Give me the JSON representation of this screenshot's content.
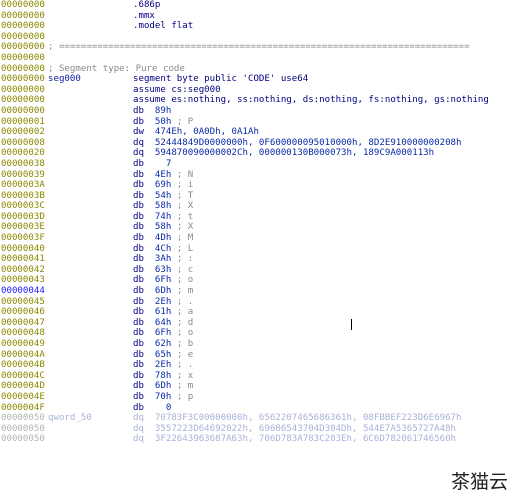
{
  "lines": [
    {
      "addr": "00000000",
      "kind": "instr",
      "mn": ".686p",
      "ops": "",
      "cmt": ""
    },
    {
      "addr": "00000000",
      "kind": "instr",
      "mn": ".mmx",
      "ops": "",
      "cmt": ""
    },
    {
      "addr": "00000000",
      "kind": "instr",
      "mn": ".model flat",
      "ops": "",
      "cmt": ""
    },
    {
      "addr": "00000000",
      "kind": "blank"
    },
    {
      "addr": "00000000",
      "kind": "comment",
      "text": "; ==========================================================================="
    },
    {
      "addr": "00000000",
      "kind": "blank"
    },
    {
      "addr": "00000000",
      "kind": "comment",
      "text": "; Segment type: Pure code"
    },
    {
      "addr": "00000000",
      "kind": "instr",
      "label": "seg000",
      "mn": "segment byte public 'CODE' use64",
      "ops": "",
      "cmt": ""
    },
    {
      "addr": "00000000",
      "kind": "instr",
      "mn": "assume cs:seg000",
      "ops": "",
      "cmt": ""
    },
    {
      "addr": "00000000",
      "kind": "instr",
      "mn": "assume es:nothing, ss:nothing, ds:nothing, fs:nothing, gs:nothing",
      "ops": "",
      "cmt": ""
    },
    {
      "addr": "00000000",
      "kind": "instr",
      "mn": "db",
      "ops": "89h",
      "cmt": ""
    },
    {
      "addr": "00000001",
      "kind": "instr",
      "mn": "db",
      "ops": "50h",
      "cmt": "; P"
    },
    {
      "addr": "00000002",
      "kind": "instr",
      "mn": "dw",
      "ops": "474Eh, 0A0Dh, 0A1Ah",
      "cmt": ""
    },
    {
      "addr": "00000008",
      "kind": "instr",
      "mn": "dq",
      "ops": "52444849D0000000h, 0F600000095010000h, 8D2E910000000208h",
      "cmt": ""
    },
    {
      "addr": "00000020",
      "kind": "instr",
      "mn": "dq",
      "ops": "594870090000002Ch, 000000130B000073h, 189C9A000113h",
      "cmt": ""
    },
    {
      "addr": "00000038",
      "kind": "instr",
      "mn": "db",
      "ops": "  7",
      "cmt": ""
    },
    {
      "addr": "00000039",
      "kind": "instr",
      "mn": "db",
      "ops": "4Eh",
      "cmt": "; N"
    },
    {
      "addr": "0000003A",
      "kind": "instr",
      "mn": "db",
      "ops": "69h",
      "cmt": "; i"
    },
    {
      "addr": "0000003B",
      "kind": "instr",
      "mn": "db",
      "ops": "54h",
      "cmt": "; T"
    },
    {
      "addr": "0000003C",
      "kind": "instr",
      "mn": "db",
      "ops": "58h",
      "cmt": "; X"
    },
    {
      "addr": "0000003D",
      "kind": "instr",
      "mn": "db",
      "ops": "74h",
      "cmt": "; t"
    },
    {
      "addr": "0000003E",
      "kind": "instr",
      "mn": "db",
      "ops": "58h",
      "cmt": "; X"
    },
    {
      "addr": "0000003F",
      "kind": "instr",
      "mn": "db",
      "ops": "4Dh",
      "cmt": "; M"
    },
    {
      "addr": "00000040",
      "kind": "instr",
      "mn": "db",
      "ops": "4Ch",
      "cmt": "; L"
    },
    {
      "addr": "00000041",
      "kind": "instr",
      "mn": "db",
      "ops": "3Ah",
      "cmt": "; :"
    },
    {
      "addr": "00000042",
      "kind": "instr",
      "mn": "db",
      "ops": "63h",
      "cmt": "; c"
    },
    {
      "addr": "00000043",
      "kind": "instr",
      "mn": "db",
      "ops": "6Fh",
      "cmt": "; o"
    },
    {
      "addr": "00000044",
      "kind": "instr",
      "mn": "db",
      "ops": "6Dh",
      "cmt": "; m",
      "highlight": true
    },
    {
      "addr": "00000045",
      "kind": "instr",
      "mn": "db",
      "ops": "2Eh",
      "cmt": "; ."
    },
    {
      "addr": "00000046",
      "kind": "instr",
      "mn": "db",
      "ops": "61h",
      "cmt": "; a"
    },
    {
      "addr": "00000047",
      "kind": "instr",
      "mn": "db",
      "ops": "64h",
      "cmt": "; d"
    },
    {
      "addr": "00000048",
      "kind": "instr",
      "mn": "db",
      "ops": "6Fh",
      "cmt": "; o"
    },
    {
      "addr": "00000049",
      "kind": "instr",
      "mn": "db",
      "ops": "62h",
      "cmt": "; b"
    },
    {
      "addr": "0000004A",
      "kind": "instr",
      "mn": "db",
      "ops": "65h",
      "cmt": "; e"
    },
    {
      "addr": "0000004B",
      "kind": "instr",
      "mn": "db",
      "ops": "2Eh",
      "cmt": "; ."
    },
    {
      "addr": "0000004C",
      "kind": "instr",
      "mn": "db",
      "ops": "78h",
      "cmt": "; x"
    },
    {
      "addr": "0000004D",
      "kind": "instr",
      "mn": "db",
      "ops": "6Dh",
      "cmt": "; m"
    },
    {
      "addr": "0000004E",
      "kind": "instr",
      "mn": "db",
      "ops": "70h",
      "cmt": "; p"
    },
    {
      "addr": "0000004F",
      "kind": "instr",
      "mn": "db",
      "ops": "  0",
      "cmt": ""
    },
    {
      "addr": "00000050",
      "kind": "instr",
      "label": "qword_50",
      "mn": "dq",
      "ops": "70783F3C00000000h, 6562207465686361h, 08FBBEF223D6E6967h",
      "cmt": "",
      "dim": true
    },
    {
      "addr": "00000050",
      "kind": "instr",
      "mn": "dq",
      "ops": "3557223D64692022h, 69686543704D304Dh, 544E7A5365727A48h",
      "cmt": "",
      "dim": true
    },
    {
      "addr": "00000050",
      "kind": "instr",
      "mn": "dq",
      "ops": "3F22643963687A63h, 706D783A783C203Eh, 6C6D782061746560h",
      "cmt": "",
      "dim": true
    }
  ],
  "watermark": "茶猫云"
}
